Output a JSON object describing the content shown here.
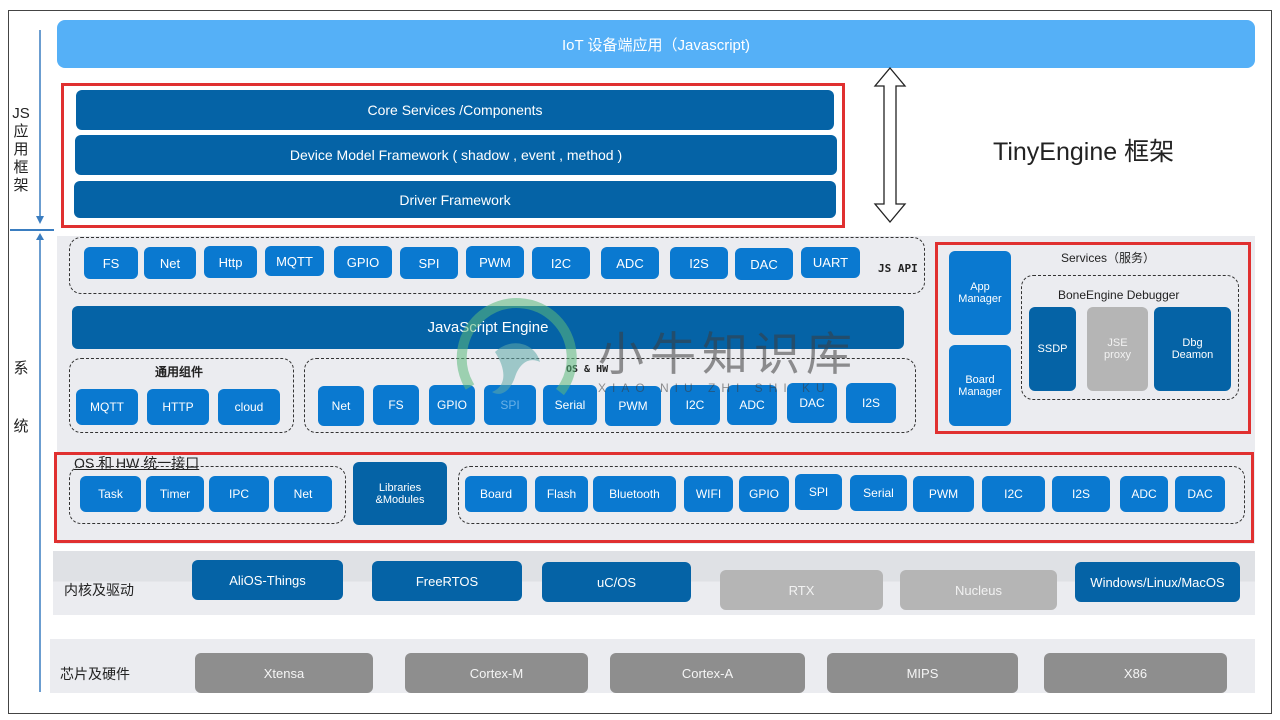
{
  "top_bar": {
    "label": "IoT 设备端应用（Javascript)"
  },
  "side_labels": {
    "js_framework": [
      "JS",
      "应",
      "用",
      "框",
      "架"
    ],
    "system": [
      "系",
      "统"
    ]
  },
  "framework_title": "TinyEngine 框架",
  "js_framework_layers": [
    "Core Services /Components",
    "Device Model Framework ( shadow , event , method )",
    "Driver Framework"
  ],
  "js_api": {
    "label": "JS API",
    "items": [
      "FS",
      "Net",
      "Http",
      "MQTT",
      "GPIO",
      "SPI",
      "PWM",
      "I2C",
      "ADC",
      "I2S",
      "DAC",
      "UART"
    ]
  },
  "javascript_engine": {
    "label": "JavaScript Engine"
  },
  "common_components": {
    "title": "通用组件",
    "items": [
      "MQTT",
      "HTTP",
      "cloud"
    ]
  },
  "os_hw": {
    "title": "OS & HW",
    "items": [
      "Net",
      "FS",
      "GPIO",
      "SPI",
      "Serial",
      "PWM",
      "I2C",
      "ADC",
      "DAC",
      "I2S"
    ]
  },
  "services": {
    "title": "Services（服务）",
    "app_manager": "App Manager",
    "board_manager": "Board Manager",
    "debugger": {
      "title": "BoneEngine Debugger",
      "ssdp": "SSDP",
      "jse_proxy": "JSE proxy",
      "dbg_deamon": "Dbg Deamon"
    }
  },
  "unified_interface": {
    "title": "OS 和 HW 统一接口",
    "os_items": [
      "Task",
      "Timer",
      "IPC",
      "Net"
    ],
    "libraries": "Libraries &Modules",
    "hw_items": [
      "Board",
      "Flash",
      "Bluetooth",
      "WIFI",
      "GPIO",
      "SPI",
      "Serial",
      "PWM",
      "I2C",
      "I2S",
      "ADC",
      "DAC"
    ]
  },
  "kernel_drivers": {
    "label": "内核及驱动",
    "items": [
      {
        "name": "AliOS-Things",
        "status": "supported"
      },
      {
        "name": "FreeRTOS",
        "status": "supported"
      },
      {
        "name": "uC/OS",
        "status": "supported"
      },
      {
        "name": "RTX",
        "status": "unsupported"
      },
      {
        "name": "Nucleus",
        "status": "unsupported"
      },
      {
        "name": "Windows/Linux/MacOS",
        "status": "supported"
      }
    ]
  },
  "chips_hardware": {
    "label": "芯片及硬件",
    "items": [
      "Xtensa",
      "Cortex-M",
      "Cortex-A",
      "MIPS",
      "X86"
    ]
  },
  "watermark": {
    "title": "小牛知识库",
    "subtitle": "XIAO NIU ZHI SHI KU"
  },
  "colors": {
    "top_bar": "#55b0f7",
    "dark_blue": "#0563a6",
    "mid_blue": "#0a79d0",
    "gray_unsupported": "#b5b5b5",
    "gray_chip": "#8e8e8e",
    "highlight_red": "#e03030",
    "panel": "#ebecf0"
  }
}
